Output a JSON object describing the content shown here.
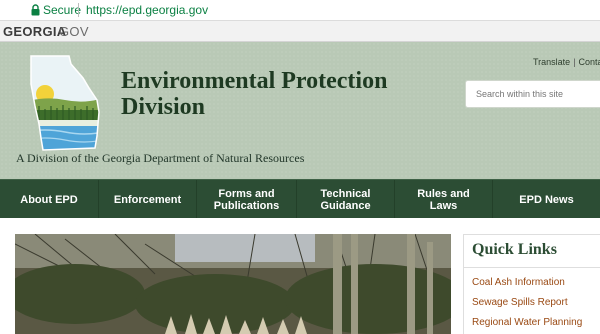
{
  "browser": {
    "secure_label": "Secure",
    "url": "https://epd.georgia.gov",
    "secure_color": "#0b8043"
  },
  "gov_strip": {
    "brand_bold": "GEORGIA",
    "brand_light": "GOV"
  },
  "header": {
    "title_line1": "Environmental Protection",
    "title_line2": "Division",
    "subtitle": "A Division of the Georgia Department of Natural Resources",
    "translate_link": "Translate",
    "contact_link": "Conta",
    "search_placeholder": "Search within this site",
    "logo_icon": "georgia-state-landscape-logo"
  },
  "nav": {
    "items": [
      {
        "line1": "About EPD",
        "line2": ""
      },
      {
        "line1": "Enforcement",
        "line2": ""
      },
      {
        "line1": "Forms and",
        "line2": "Publications"
      },
      {
        "line1": "Technical",
        "line2": "Guidance"
      },
      {
        "line1": "Rules and",
        "line2": "Laws"
      },
      {
        "line1": "EPD News",
        "line2": ""
      }
    ]
  },
  "quick_links": {
    "heading": "Quick Links",
    "links": [
      "Coal Ash Information",
      "Sewage Spills Report",
      "Regional Water Planning"
    ]
  },
  "colors": {
    "header_bg": "#b9c9b6",
    "nav_bg": "#2c4d34",
    "title": "#1e3a22",
    "link": "#9a4a14"
  }
}
